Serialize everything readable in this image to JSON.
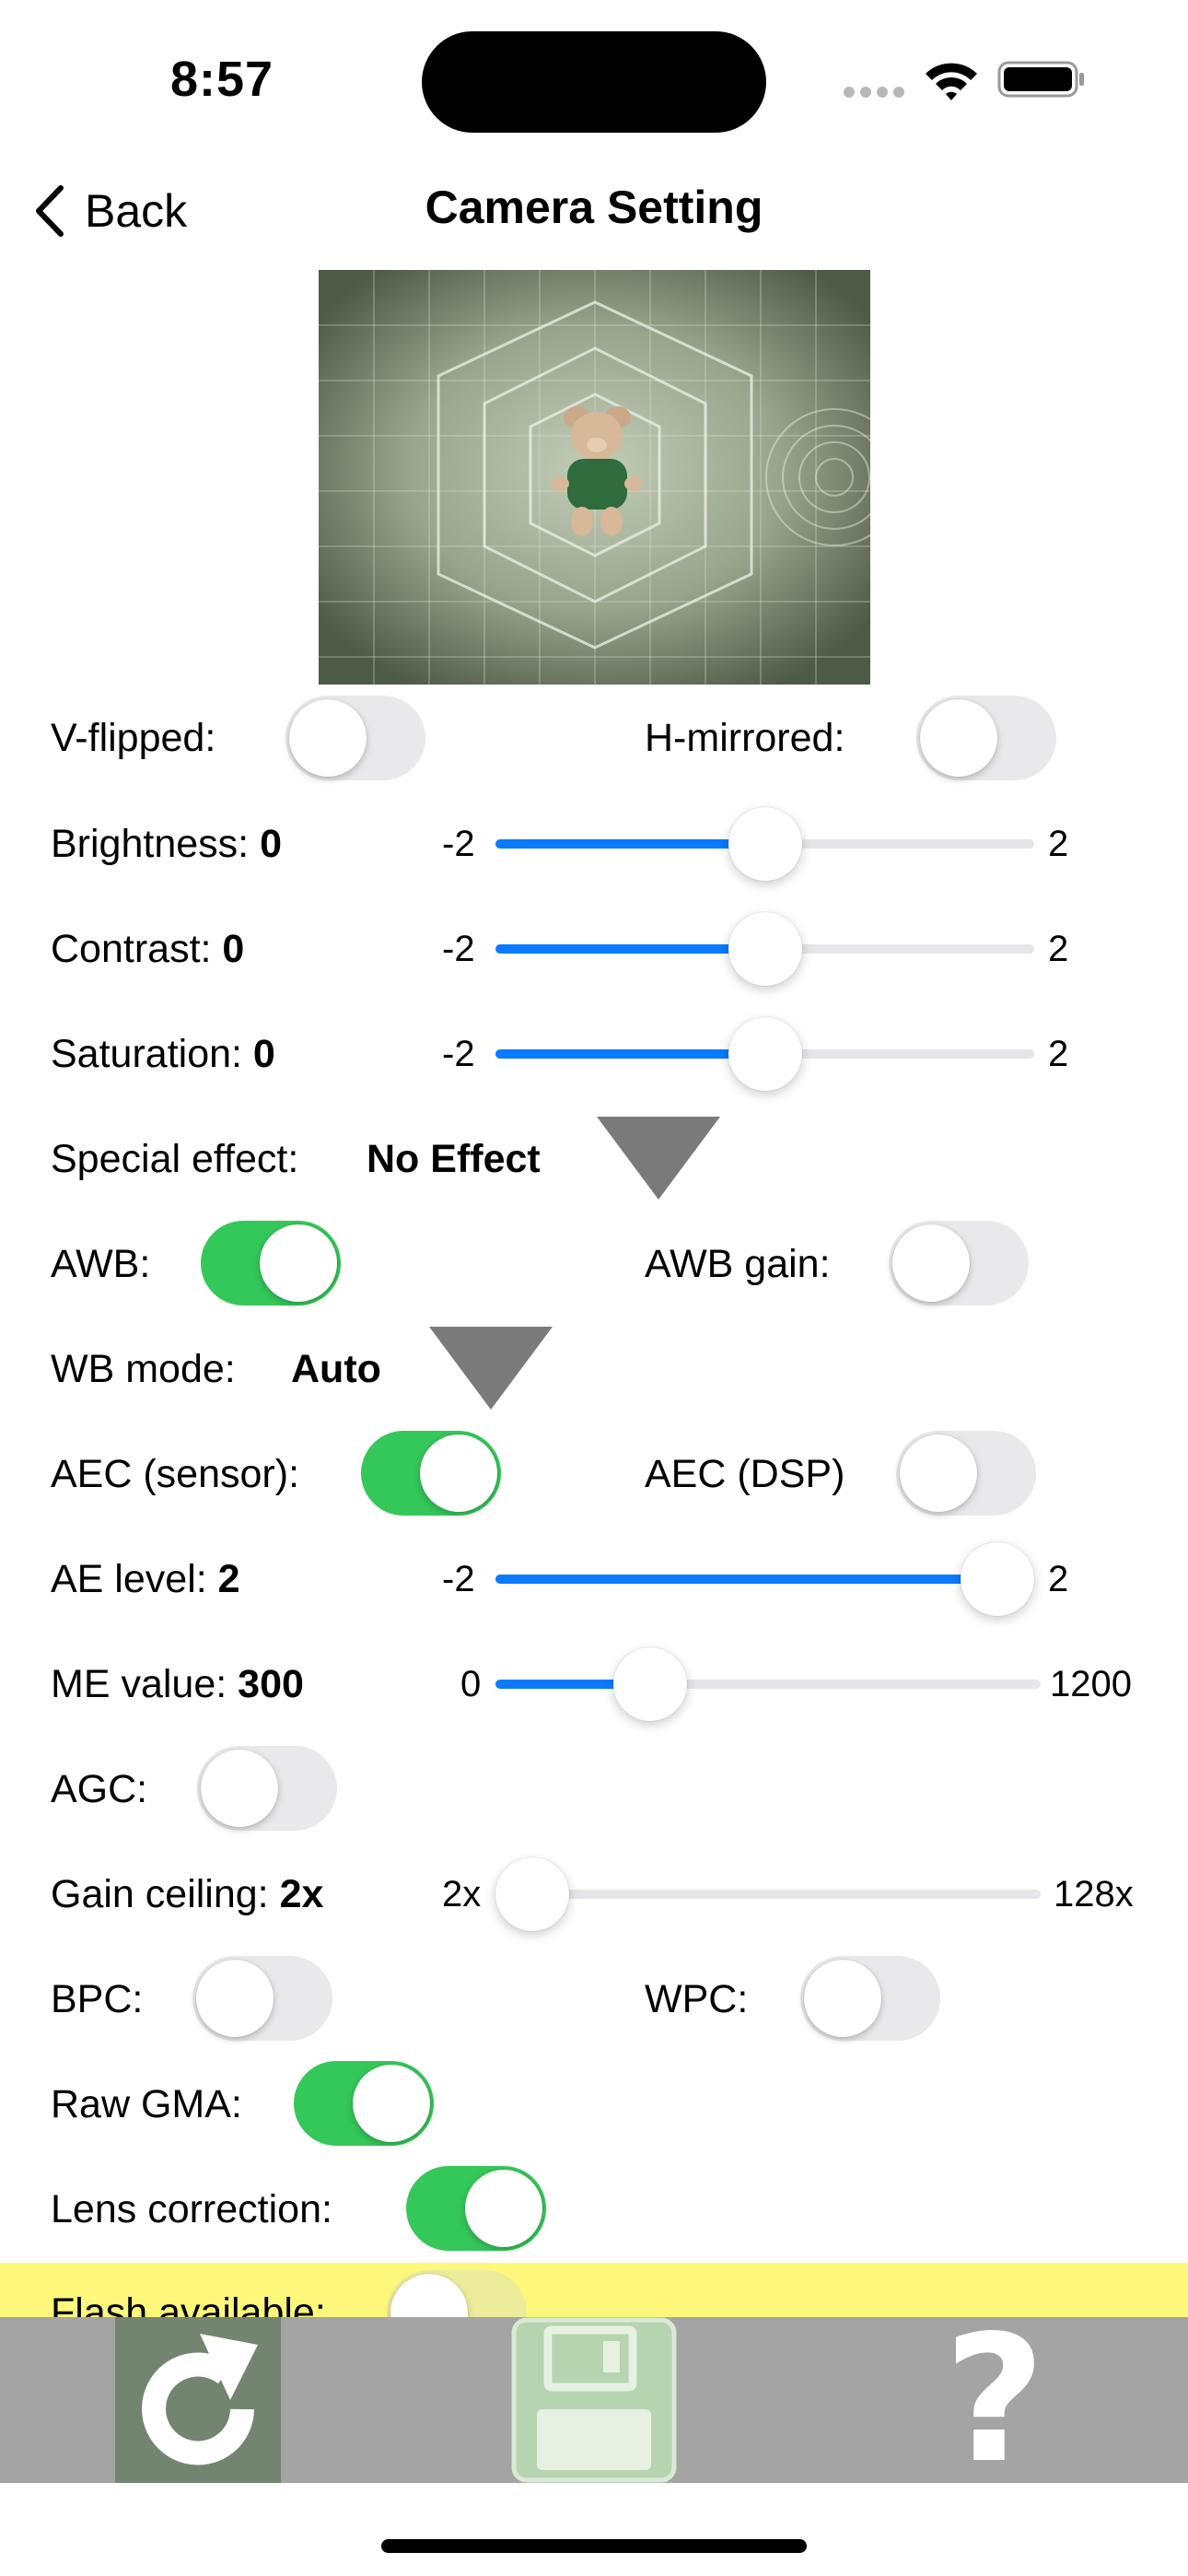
{
  "status": {
    "time": "8:57"
  },
  "nav": {
    "back": "Back",
    "title": "Camera Setting"
  },
  "flip": {
    "v_label": "V-flipped:",
    "v_on": false,
    "h_label": "H-mirrored:",
    "h_on": false
  },
  "brightness": {
    "label": "Brightness:",
    "value": "0",
    "min": "-2",
    "max": "2",
    "level": 0.5
  },
  "contrast": {
    "label": "Contrast:",
    "value": "0",
    "min": "-2",
    "max": "2",
    "level": 0.5
  },
  "saturation": {
    "label": "Saturation:",
    "value": "0",
    "min": "-2",
    "max": "2",
    "level": 0.5
  },
  "special_effect": {
    "label": "Special effect:",
    "value": "No Effect"
  },
  "awb": {
    "label": "AWB:",
    "on": true,
    "gain_label": "AWB gain:",
    "gain_on": false
  },
  "wb_mode": {
    "label": "WB mode:",
    "value": "Auto"
  },
  "aec": {
    "sensor_label": "AEC (sensor):",
    "sensor_on": true,
    "dsp_label": "AEC (DSP)",
    "dsp_on": false
  },
  "ae_level": {
    "label": "AE level:",
    "value": "2",
    "min": "-2",
    "max": "2",
    "level": 1.0
  },
  "me_value": {
    "label": "ME value:",
    "value": "300",
    "min": "0",
    "max": "1200",
    "level": 0.25
  },
  "agc": {
    "label": "AGC:",
    "on": false
  },
  "gain_ceiling": {
    "label": "Gain ceiling:",
    "value": "2x",
    "min": "2x",
    "max": "128x",
    "level": 0.0
  },
  "bpc": {
    "label": "BPC:",
    "on": false,
    "wpc_label": "WPC:",
    "wpc_on": false
  },
  "raw_gma": {
    "label": "Raw GMA:",
    "on": true
  },
  "lens_correction": {
    "label": "Lens correction:",
    "on": true
  },
  "flash": {
    "label": "Flash available:",
    "on": false,
    "highlight_color": "#fdf87b"
  },
  "toolbar": {
    "icons": [
      "refresh-icon",
      "save-disk-icon",
      "help-icon"
    ],
    "help_glyph": "?"
  },
  "colors": {
    "toggle_on": "#34c759",
    "slider_fill": "#0a7aff",
    "toolbar_bg": "#a4a4a4"
  }
}
